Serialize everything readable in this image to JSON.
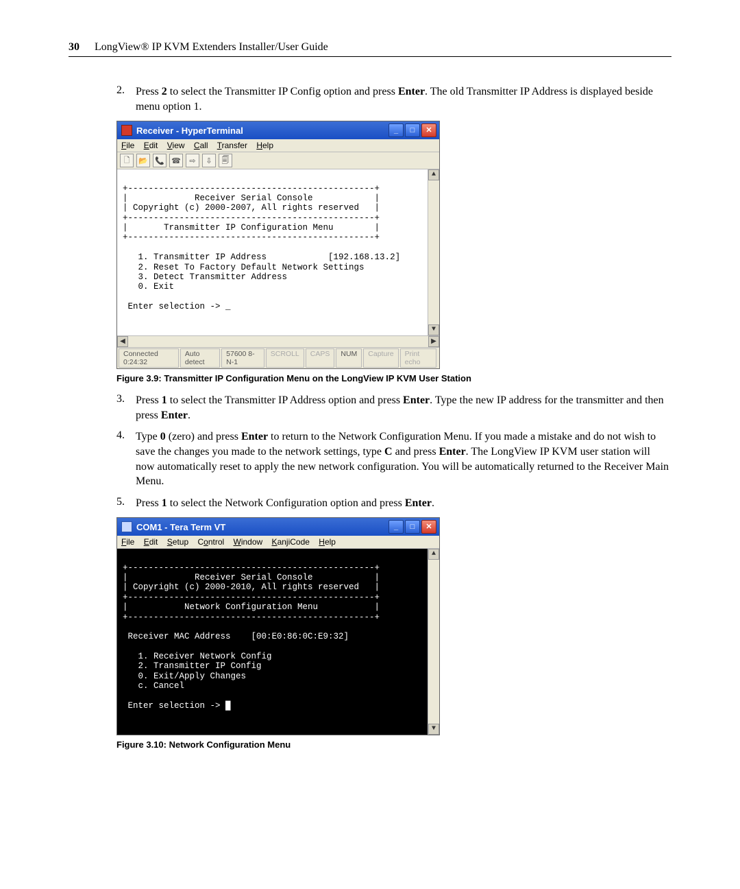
{
  "header": {
    "page_number": "30",
    "title": "LongView® IP KVM Extenders Installer/User Guide"
  },
  "steps_a": [
    {
      "num": "2.",
      "segments": [
        "Press ",
        "2",
        " to select the Transmitter IP Config option and press ",
        "Enter",
        ". The old Transmitter IP Address is displayed beside menu option 1."
      ]
    }
  ],
  "fig1": {
    "window_title": "Receiver - HyperTerminal",
    "menus": [
      "File",
      "Edit",
      "View",
      "Call",
      "Transfer",
      "Help"
    ],
    "toolbar_icons": [
      "new-doc-icon",
      "open-icon",
      "print-icon",
      "phone-icon",
      "disconnect-icon",
      "props-icon",
      "help-icon"
    ],
    "content_lines": [
      "+------------------------------------------------+",
      "|             Receiver Serial Console            |",
      "| Copyright (c) 2000-2007, All rights reserved   |",
      "+------------------------------------------------+",
      "|       Transmitter IP Configuration Menu        |",
      "+------------------------------------------------+",
      "",
      "   1. Transmitter IP Address            [192.168.13.2]",
      "   2. Reset To Factory Default Network Settings",
      "   3. Detect Transmitter Address",
      "   0. Exit",
      "",
      " Enter selection -> _"
    ],
    "status": {
      "connected": "Connected 0:24:32",
      "detect": "Auto detect",
      "baud": "57600 8-N-1",
      "scroll": "SCROLL",
      "caps": "CAPS",
      "num": "NUM",
      "capture": "Capture",
      "echo": "Print echo"
    },
    "caption": "Figure 3.9: Transmitter IP Configuration Menu on the LongView IP KVM User Station"
  },
  "steps_b": [
    {
      "num": "3.",
      "segments": [
        "Press ",
        "1",
        " to select the Transmitter IP Address option and press ",
        "Enter",
        ". Type the new IP address for the transmitter and then press ",
        "Enter",
        "."
      ]
    },
    {
      "num": "4.",
      "segments": [
        "Type ",
        "0",
        " (zero) and press ",
        "Enter",
        " to return to the Network Configuration Menu. If you made a mistake and do not wish to save the changes you made to the network settings, type ",
        "C",
        " and press ",
        "Enter",
        ". The LongView IP KVM user station will now automatically reset to apply the new network configuration. You will be automatically returned to the Receiver Main Menu."
      ]
    },
    {
      "num": "5.",
      "segments": [
        "Press ",
        "1",
        " to select the Network Configuration option and press ",
        "Enter",
        "."
      ]
    }
  ],
  "fig2": {
    "window_title": "COM1 - Tera Term VT",
    "menus": [
      "File",
      "Edit",
      "Setup",
      "Control",
      "Window",
      "KanjiCode",
      "Help"
    ],
    "content_lines": [
      "+------------------------------------------------+",
      "|             Receiver Serial Console            |",
      "| Copyright (c) 2000-2010, All rights reserved   |",
      "+------------------------------------------------+",
      "|           Network Configuration Menu           |",
      "+------------------------------------------------+",
      "",
      " Receiver MAC Address    [00:E0:86:0C:E9:32]",
      "",
      "   1. Receiver Network Config",
      "   2. Transmitter IP Config",
      "   0. Exit/Apply Changes",
      "   c. Cancel",
      "",
      " Enter selection -> █"
    ],
    "caption": "Figure 3.10: Network Configuration Menu"
  }
}
